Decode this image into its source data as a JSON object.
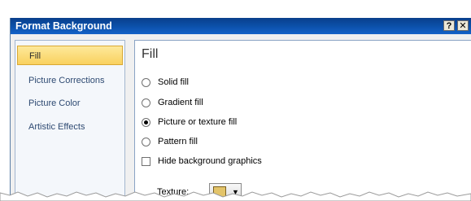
{
  "window": {
    "title": "Format Background",
    "help_label": "?",
    "close_label": "✕"
  },
  "nav": {
    "items": [
      {
        "label": "Fill",
        "selected": true
      },
      {
        "label": "Picture Corrections",
        "selected": false
      },
      {
        "label": "Picture Color",
        "selected": false
      },
      {
        "label": "Artistic Effects",
        "selected": false
      }
    ]
  },
  "panel": {
    "title": "Fill",
    "options": [
      {
        "label": "Solid fill",
        "type": "radio",
        "checked": false
      },
      {
        "label": "Gradient fill",
        "type": "radio",
        "checked": false
      },
      {
        "label": "Picture or texture fill",
        "type": "radio",
        "checked": true
      },
      {
        "label": "Pattern fill",
        "type": "radio",
        "checked": false
      },
      {
        "label": "Hide background graphics",
        "type": "checkbox",
        "checked": false
      }
    ],
    "texture_label": "Texture:",
    "texture_dropdown_icon": "chevron-down-icon"
  },
  "colors": {
    "titlebar": "#0b4ea6",
    "selected_nav": "#f9d15f",
    "panel_border": "#8aa3c4"
  }
}
